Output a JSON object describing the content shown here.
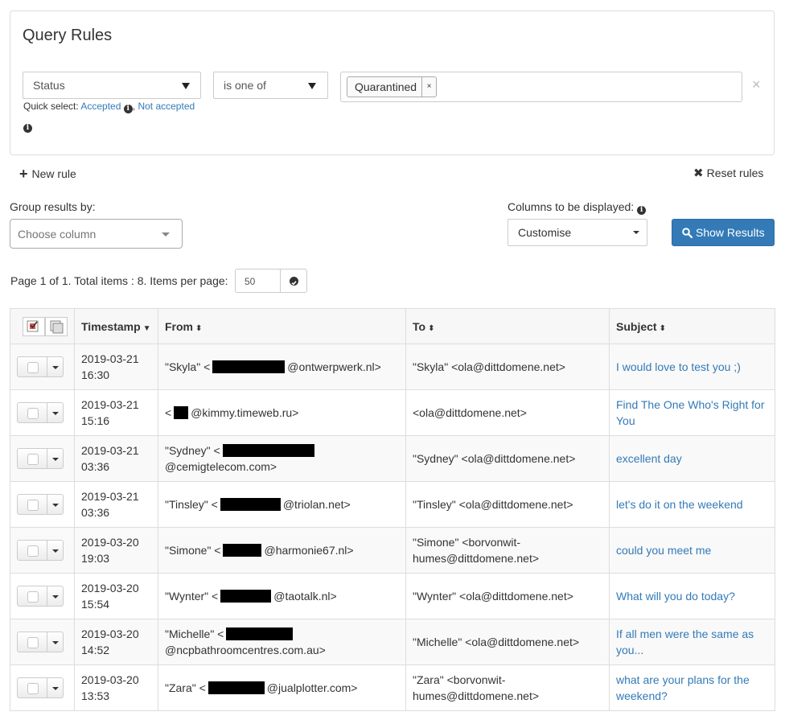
{
  "query_rules": {
    "title": "Query Rules",
    "field_select": "Status",
    "operator_select": "is one of",
    "value_tags": [
      "Quarantined"
    ],
    "tag_remove": "×",
    "remove_rule": "×",
    "quick_select_label": "Quick select:",
    "quick_select_accepted": "Accepted",
    "quick_select_sep": ",",
    "quick_select_not_accepted": "Not accepted"
  },
  "actions": {
    "new_rule": "New rule",
    "reset_rules": "Reset rules"
  },
  "group_by": {
    "label": "Group results by:",
    "placeholder": "Choose column"
  },
  "columns": {
    "label": "Columns to be displayed:",
    "value": "Customise"
  },
  "show_results": "Show Results",
  "pager": {
    "text": "Page 1 of 1. Total items : 8. Items per page:",
    "items_per_page": "50"
  },
  "table": {
    "headers": {
      "timestamp": "Timestamp",
      "from": "From",
      "to": "To",
      "subject": "Subject"
    },
    "rows": [
      {
        "timestamp": "2019-03-21 16:30",
        "from_name": "\"Skyla\" <",
        "from_domain": "@ontwerpwerk.nl>",
        "to": "\"Skyla\" <ola@dittdomene.net>",
        "subject": "I would love to test you ;)"
      },
      {
        "timestamp": "2019-03-21 15:16",
        "from_name": "<",
        "from_domain": "@kimmy.timeweb.ru>",
        "to": "<ola@dittdomene.net>",
        "subject": "Find The One Who's Right for You"
      },
      {
        "timestamp": "2019-03-21 03:36",
        "from_name": "\"Sydney\" <",
        "from_domain": "@cemigtelecom.com>",
        "to": "\"Sydney\" <ola@dittdomene.net>",
        "subject": "excellent day"
      },
      {
        "timestamp": "2019-03-21 03:36",
        "from_name": "\"Tinsley\" <",
        "from_domain": "@triolan.net>",
        "to": "\"Tinsley\" <ola@dittdomene.net>",
        "subject": "let's do it on the weekend"
      },
      {
        "timestamp": "2019-03-20 19:03",
        "from_name": "\"Simone\" <",
        "from_domain": "@harmonie67.nl>",
        "to": "\"Simone\" <borvonwit-humes@dittdomene.net>",
        "subject": "could you meet me"
      },
      {
        "timestamp": "2019-03-20 15:54",
        "from_name": "\"Wynter\" <",
        "from_domain": "@taotalk.nl>",
        "to": "\"Wynter\" <ola@dittdomene.net>",
        "subject": "What will you do today?"
      },
      {
        "timestamp": "2019-03-20 14:52",
        "from_name": "\"Michelle\" <",
        "from_domain": "@ncpbathroomcentres.com.au>",
        "to": "\"Michelle\" <ola@dittdomene.net>",
        "subject": "If all men were the same as you..."
      },
      {
        "timestamp": "2019-03-20 13:53",
        "from_name": "\"Zara\" <",
        "from_domain": "@jualplotter.com>",
        "to": "\"Zara\" <borvonwit-humes@dittdomene.net>",
        "subject": "what are your plans for the weekend?"
      }
    ]
  }
}
